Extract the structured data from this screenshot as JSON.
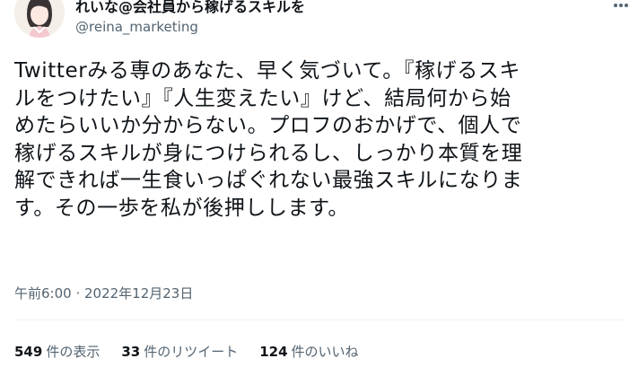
{
  "tweet": {
    "author": {
      "display_name": "れいな@会社員から稼げるスキルを",
      "handle": "@reina_marketing"
    },
    "text_lines": [
      "Twitterみる専のあなた、早く気づいて。『稼げるスキ",
      "ルをつけたい』『人生変えたい』けど、結局何から始",
      "めたらいいか分からない。プロフのおかげで、個人で",
      "稼げるスキルが身につけられるし、しっかり本質を理",
      "解できれば一生食いっぱぐれない最強スキルになりま",
      "す。その一歩を私が後押しします。"
    ],
    "timestamp": "午前6:00 · 2022年12月23日",
    "stats": {
      "views_count": "549",
      "views_label": "件の表示",
      "retweets_count": "33",
      "retweets_label": "件のリツイート",
      "likes_count": "124",
      "likes_label": "件のいいね"
    }
  },
  "colors": {
    "text_primary": "#0f1419",
    "text_secondary": "#536471",
    "divider": "#eff3f4"
  },
  "icons": {
    "more": "more-dots-icon"
  }
}
